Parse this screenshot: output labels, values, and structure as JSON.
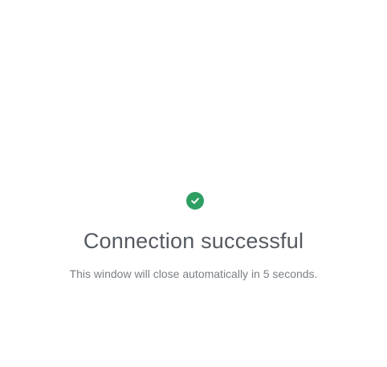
{
  "status": {
    "icon": "check-circle-icon",
    "color": "#2e9e63"
  },
  "title": "Connection successful",
  "message": "This window will close automatically in 5 seconds."
}
